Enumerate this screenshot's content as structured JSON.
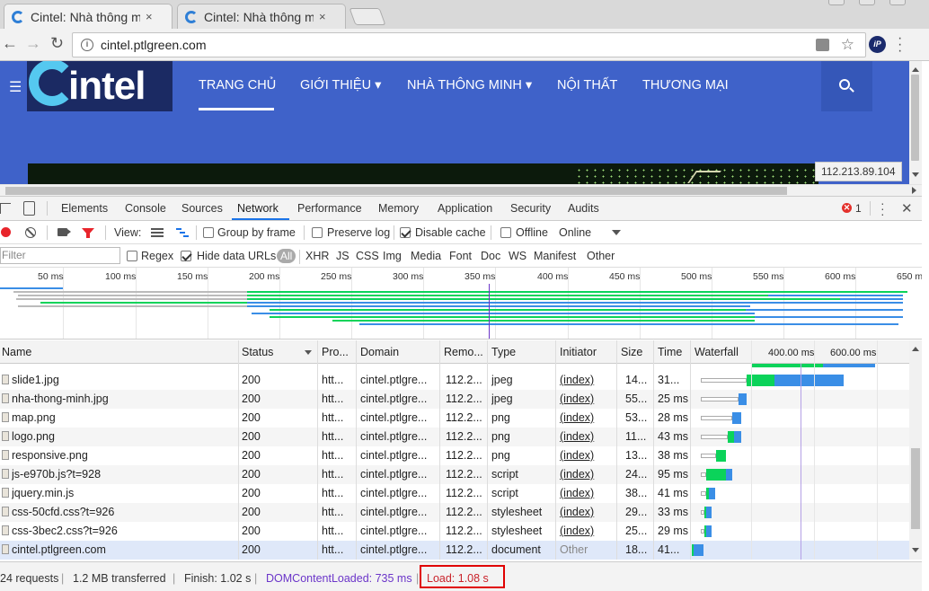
{
  "browser": {
    "tabs": [
      {
        "title": "Cintel: Nhà thông m",
        "close": "×"
      },
      {
        "title": "Cintel: Nhà thông m",
        "close": "×"
      }
    ],
    "url": "cintel.ptlgreen.com",
    "extension_label": "iP"
  },
  "site": {
    "logo_text": "intel",
    "menu": [
      "TRANG CHỦ",
      "GIỚI THIỆU ▾",
      "NHÀ THÔNG MINH ▾",
      "NỘI THẤT",
      "THƯƠNG MẠI"
    ],
    "ip_tooltip": "112.213.89.104"
  },
  "devtools": {
    "tabs": [
      "Elements",
      "Console",
      "Sources",
      "Network",
      "Performance",
      "Memory",
      "Application",
      "Security",
      "Audits"
    ],
    "active_tab": "Network",
    "error_count": "1",
    "toolbar": {
      "view_label": "View:",
      "group_by_frame": "Group by frame",
      "preserve_log": "Preserve log",
      "disable_cache": "Disable cache",
      "offline": "Offline",
      "throttle": "Online"
    },
    "filter": {
      "placeholder": "Filter",
      "regex": "Regex",
      "hide_data_urls": "Hide data URLs",
      "types": [
        "All",
        "XHR",
        "JS",
        "CSS",
        "Img",
        "Media",
        "Font",
        "Doc",
        "WS",
        "Manifest",
        "Other"
      ]
    },
    "overview_ticks": [
      "50 ms",
      "100 ms",
      "150 ms",
      "200 ms",
      "250 ms",
      "300 ms",
      "350 ms",
      "400 ms",
      "450 ms",
      "500 ms",
      "550 ms",
      "600 ms",
      "650 m"
    ],
    "columns": [
      "Name",
      "Status",
      "Pro...",
      "Domain",
      "Remo...",
      "Type",
      "Initiator",
      "Size",
      "Time",
      "Waterfall"
    ],
    "waterfall_scale": [
      "400.00 ms",
      "600.00 ms"
    ],
    "rows": [
      {
        "name": "slide1.jpg",
        "status": "200",
        "protocol": "htt...",
        "domain": "cintel.ptlgre...",
        "remote": "112.2...",
        "type": "jpeg",
        "initiator": "(index)",
        "size": "14...",
        "time": "31..."
      },
      {
        "name": "nha-thong-minh.jpg",
        "status": "200",
        "protocol": "htt...",
        "domain": "cintel.ptlgre...",
        "remote": "112.2...",
        "type": "jpeg",
        "initiator": "(index)",
        "size": "55...",
        "time": "25 ms"
      },
      {
        "name": "map.png",
        "status": "200",
        "protocol": "htt...",
        "domain": "cintel.ptlgre...",
        "remote": "112.2...",
        "type": "png",
        "initiator": "(index)",
        "size": "53...",
        "time": "28 ms"
      },
      {
        "name": "logo.png",
        "status": "200",
        "protocol": "htt...",
        "domain": "cintel.ptlgre...",
        "remote": "112.2...",
        "type": "png",
        "initiator": "(index)",
        "size": "11...",
        "time": "43 ms"
      },
      {
        "name": "responsive.png",
        "status": "200",
        "protocol": "htt...",
        "domain": "cintel.ptlgre...",
        "remote": "112.2...",
        "type": "png",
        "initiator": "(index)",
        "size": "13...",
        "time": "38 ms"
      },
      {
        "name": "js-e970b.js?t=928",
        "status": "200",
        "protocol": "htt...",
        "domain": "cintel.ptlgre...",
        "remote": "112.2...",
        "type": "script",
        "initiator": "(index)",
        "size": "24...",
        "time": "95 ms"
      },
      {
        "name": "jquery.min.js",
        "status": "200",
        "protocol": "htt...",
        "domain": "cintel.ptlgre...",
        "remote": "112.2...",
        "type": "script",
        "initiator": "(index)",
        "size": "38...",
        "time": "41 ms"
      },
      {
        "name": "css-50cfd.css?t=926",
        "status": "200",
        "protocol": "htt...",
        "domain": "cintel.ptlgre...",
        "remote": "112.2...",
        "type": "stylesheet",
        "initiator": "(index)",
        "size": "29...",
        "time": "33 ms"
      },
      {
        "name": "css-3bec2.css?t=926",
        "status": "200",
        "protocol": "htt...",
        "domain": "cintel.ptlgre...",
        "remote": "112.2...",
        "type": "stylesheet",
        "initiator": "(index)",
        "size": "25...",
        "time": "29 ms"
      },
      {
        "name": "cintel.ptlgreen.com",
        "status": "200",
        "protocol": "htt...",
        "domain": "cintel.ptlgre...",
        "remote": "112.2...",
        "type": "document",
        "initiator": "Other",
        "size": "18...",
        "time": "41..."
      }
    ],
    "summary": {
      "requests": "24 requests",
      "transferred": "1.2 MB transferred",
      "finish": "Finish: 1.02 s",
      "dcl": "DOMContentLoaded: 735 ms",
      "load": "Load: 1.08 s"
    },
    "colors": {
      "waiting": "#0bd35a",
      "download": "#3a8ee6",
      "dcl": "#6b35c9",
      "load": "#c9222a",
      "record": "#e8242b"
    }
  }
}
